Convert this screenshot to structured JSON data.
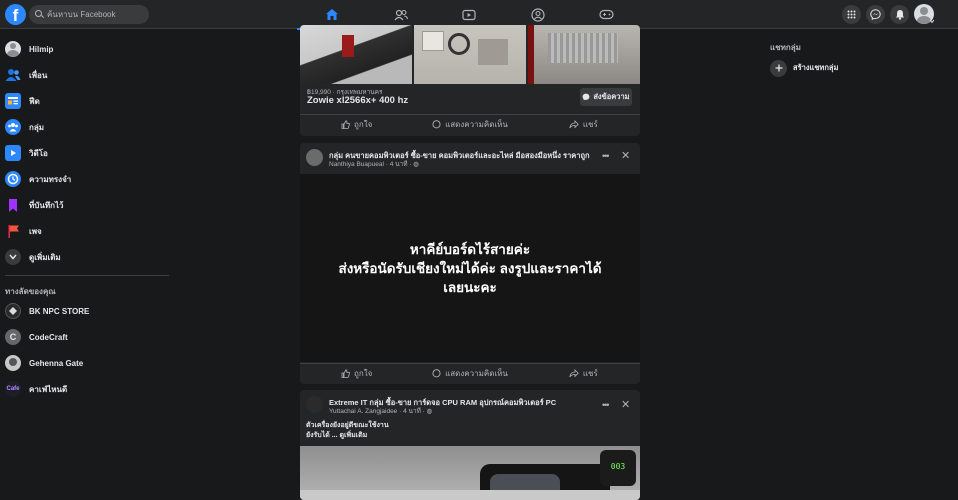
{
  "topbar": {
    "search_placeholder": "ค้นหาบน Facebook",
    "logo_letter": "f",
    "tabs": [
      "home-icon",
      "friends-icon",
      "watch-icon",
      "groups-icon",
      "gaming-icon"
    ],
    "accent": "#2d88ff"
  },
  "sidebar": {
    "items": [
      {
        "label": "Hilmip",
        "icon": "profile-avatar"
      },
      {
        "label": "เพื่อน",
        "icon": "friends-icon"
      },
      {
        "label": "ฟีด",
        "icon": "feed-icon"
      },
      {
        "label": "กลุ่ม",
        "icon": "groups-icon"
      },
      {
        "label": "วิดีโอ",
        "icon": "video-icon"
      },
      {
        "label": "ความทรงจำ",
        "icon": "memories-icon"
      },
      {
        "label": "ที่บันทึกไว้",
        "icon": "saved-icon"
      },
      {
        "label": "เพจ",
        "icon": "pages-icon"
      },
      {
        "label": "ดูเพิ่มเติม",
        "icon": "chevron-down-icon"
      }
    ],
    "shortcuts_title": "ทางลัดของคุณ",
    "shortcuts": [
      {
        "label": "BK NPC STORE"
      },
      {
        "label": "CodeCraft",
        "letter": "C"
      },
      {
        "label": "Gehenna Gate"
      },
      {
        "label": "คาเฟ่ไหนดี"
      }
    ]
  },
  "feed": {
    "post1": {
      "price_location": "฿19,990 · กรุงเทพมหานคร",
      "item_title": "Zowie xl2566x+ 400 hz",
      "message_button": "ส่งข้อความ"
    },
    "post2": {
      "group": "กลุ่ม คนขายคอมพิวเตอร์ ซื้อ-ขาย คอมพิวเตอร์และอะไหล่ มือสองมือหนึ่ง ราคาถูก",
      "author_time": "Nanthiya Buapueal · 4 นาที · ◍",
      "text_line1": "หาคีย์บอร์ดไร้สายค่ะ",
      "text_line2": "ส่งหรือนัดรับเชียงใหม่ได้ค่ะ ลงรูปและราคาได้",
      "text_line3": "เลยนะคะ"
    },
    "post3": {
      "group": "Extreme IT กลุ่ม ซื้อ-ขาย การ์ดจอ CPU RAM อุปกรณ์คอมพิวเตอร์ PC",
      "author_time": "Yuttachai A. Zangjaidee · 4 นาที · ◍",
      "text_line1": "ตัวเครื่องยังอยู่ดีขณะใช้งาน",
      "text_line2": "ยังรับได้ ... ดูเพิ่มเติม",
      "gauge_value": "003"
    },
    "actions": {
      "like": "ถูกใจ",
      "comment": "แสดงความคิดเห็น",
      "share": "แชร์"
    }
  },
  "right": {
    "title": "แชทกลุ่ม",
    "create": "สร้างแชทกลุ่ม"
  }
}
